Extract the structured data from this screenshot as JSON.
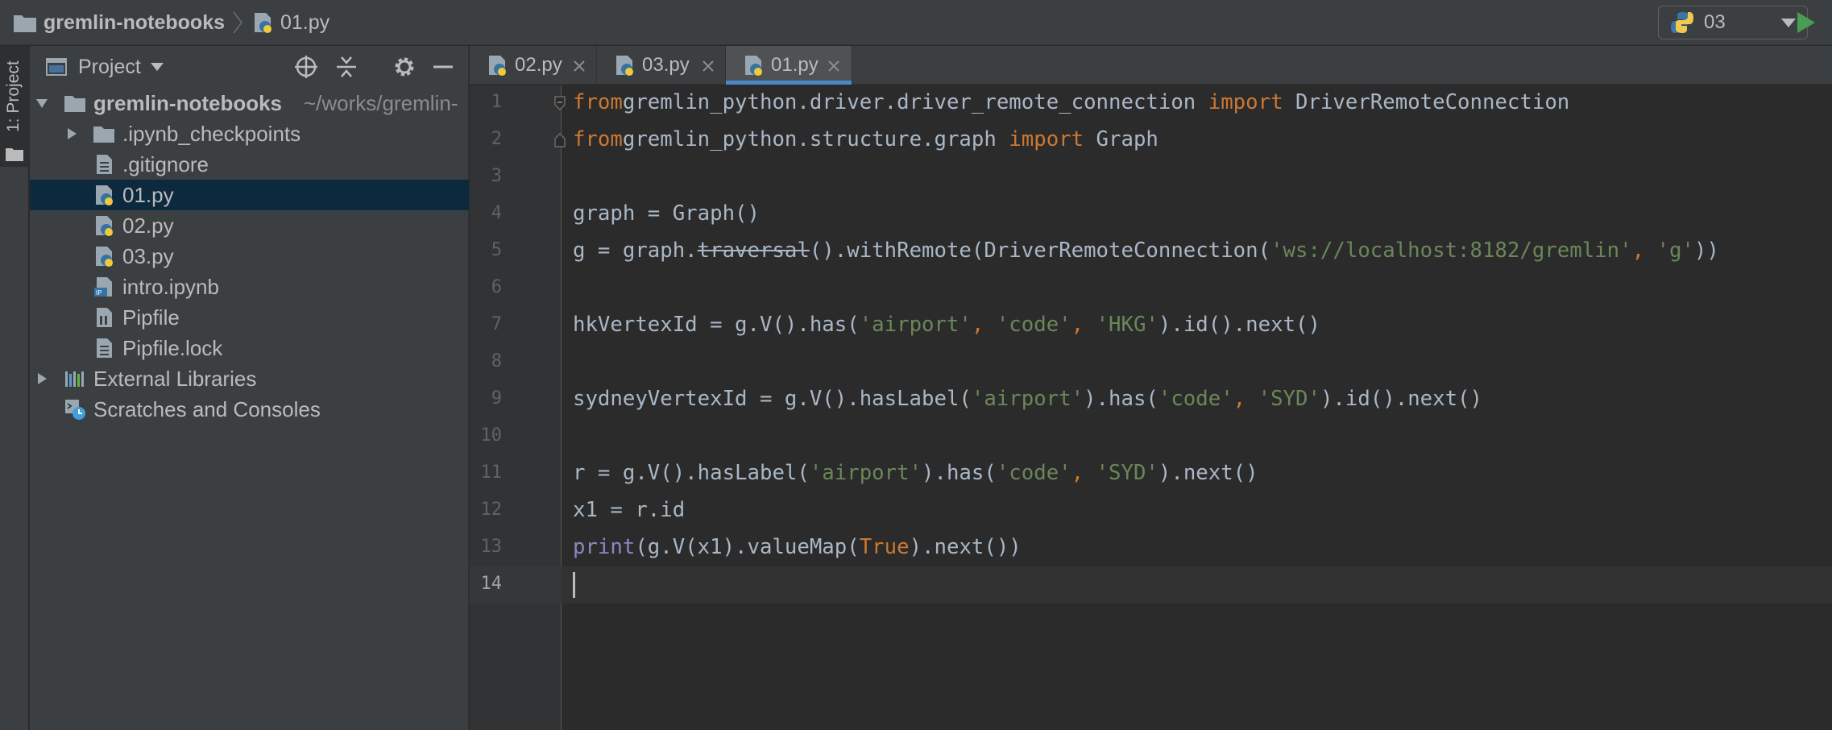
{
  "navbar": {
    "project_name": "gremlin-notebooks",
    "current_file": "01.py",
    "run_config": "03"
  },
  "toolstripe": {
    "project_tab_label": "1: Project"
  },
  "project_panel": {
    "title": "Project",
    "root": {
      "name": "gremlin-notebooks",
      "path_hint": "~/works/gremlin-"
    },
    "items": [
      {
        "label": ".ipynb_checkpoints",
        "icon": "folder-icon"
      },
      {
        "label": ".gitignore",
        "icon": "text-file-icon"
      },
      {
        "label": "01.py",
        "icon": "python-file-icon"
      },
      {
        "label": "02.py",
        "icon": "python-file-icon"
      },
      {
        "label": "03.py",
        "icon": "python-file-icon"
      },
      {
        "label": "intro.ipynb",
        "icon": "notebook-file-icon"
      },
      {
        "label": "Pipfile",
        "icon": "pipfile-icon"
      },
      {
        "label": "Pipfile.lock",
        "icon": "text-file-icon"
      }
    ],
    "external_libraries": "External Libraries",
    "scratches": "Scratches and Consoles"
  },
  "editor_tabs": [
    {
      "label": "02.py",
      "active": false
    },
    {
      "label": "03.py",
      "active": false
    },
    {
      "label": "01.py",
      "active": true
    }
  ],
  "editor": {
    "current_line": 14,
    "line_numbers": [
      "1",
      "2",
      "3",
      "4",
      "5",
      "6",
      "7",
      "8",
      "9",
      "10",
      "11",
      "12",
      "13",
      "14"
    ],
    "lines": [
      [
        [
          "kw",
          "from"
        ],
        [
          "",
          "gremlin_python.driver.driver_remote_connection "
        ],
        [
          "kw",
          "import"
        ],
        [
          "",
          " DriverRemoteConnection"
        ]
      ],
      [
        [
          "kw",
          "from"
        ],
        [
          "",
          "gremlin_python.structure.graph "
        ],
        [
          "kw",
          "import"
        ],
        [
          "",
          " Graph"
        ]
      ],
      [],
      [
        [
          "",
          "graph = Graph()"
        ]
      ],
      [
        [
          "",
          "g = graph."
        ],
        [
          "strike",
          "traversal"
        ],
        [
          "",
          "().withRemote(DriverRemoteConnection("
        ],
        [
          "str",
          "'ws://localhost:8182/gremlin'"
        ],
        [
          "kw",
          ", "
        ],
        [
          "str",
          "'g'"
        ],
        [
          "",
          "))"
        ]
      ],
      [],
      [
        [
          "",
          "hkVertexId = g.V().has("
        ],
        [
          "str",
          "'airport'"
        ],
        [
          "kw",
          ", "
        ],
        [
          "str",
          "'code'"
        ],
        [
          "kw",
          ", "
        ],
        [
          "str",
          "'HKG'"
        ],
        [
          "",
          ").id().next()"
        ]
      ],
      [],
      [
        [
          "",
          "sydneyVertexId = g.V().hasLabel("
        ],
        [
          "str",
          "'airport'"
        ],
        [
          "",
          ").has("
        ],
        [
          "str",
          "'code'"
        ],
        [
          "kw",
          ", "
        ],
        [
          "str",
          "'SYD'"
        ],
        [
          "",
          ").id().next()"
        ]
      ],
      [],
      [
        [
          "",
          "r = g.V().hasLabel("
        ],
        [
          "str",
          "'airport'"
        ],
        [
          "",
          ").has("
        ],
        [
          "str",
          "'code'"
        ],
        [
          "kw",
          ", "
        ],
        [
          "str",
          "'SYD'"
        ],
        [
          "",
          ").next()"
        ]
      ],
      [
        [
          "",
          "x1 = r.id"
        ]
      ],
      [
        [
          "bi",
          "print"
        ],
        [
          "",
          "(g.V(x1).valueMap("
        ],
        [
          "kw",
          "True"
        ],
        [
          "",
          ").next())"
        ]
      ],
      []
    ]
  },
  "colors": {
    "background": "#2b2b2b",
    "panel": "#3c3f41",
    "selection": "#0d293e",
    "keyword": "#cc7832",
    "string": "#6a8759",
    "builtin": "#8888c6",
    "run_green": "#499c54",
    "active_tab_underline": "#4a88c7"
  }
}
